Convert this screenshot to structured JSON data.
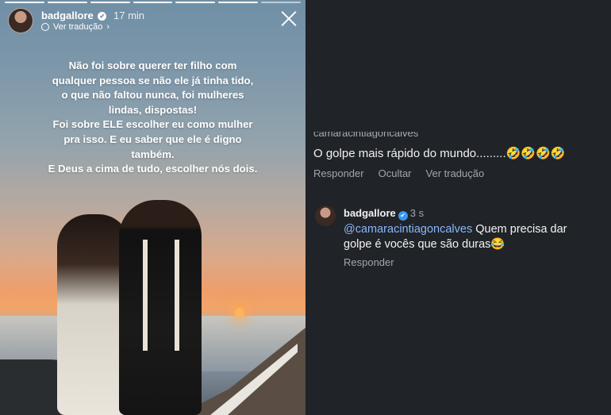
{
  "story": {
    "username": "badgallore",
    "time": "17 min",
    "translate_label": "Ver tradução",
    "translate_chevron": "›",
    "verified_mark": "✔",
    "text": "Não foi sobre querer ter filho com\nqualquer pessoa se não ele já tinha tido,\no que não faltou nunca, foi mulheres\nlindas, dispostas!\nFoi sobre ELE escolher eu como mulher\npra isso. E eu saber que ele é digno\ntambém.\nE Deus a cima de tudo, escolher nós dois.",
    "progress_segments": 7,
    "active_segments": 6
  },
  "comments": {
    "first_comment": {
      "username_partial": "camaracintiagoncalves",
      "text": "O golpe mais rápido do mundo.........🤣🤣🤣🤣",
      "actions": [
        "Responder",
        "Ocultar",
        "Ver tradução"
      ]
    },
    "reply": {
      "username": "badgallore",
      "verified_mark": "✔",
      "time": "3 s",
      "mention": "@camaracintiagoncalves",
      "text": " Quem precisa dar golpe é vocês que são duras😂",
      "actions": [
        "Responder"
      ]
    }
  },
  "colors": {
    "comments_bg": "#202327",
    "mention": "#8bb6ff",
    "verified_blue": "#3897f0"
  },
  "icons": [
    "close-icon",
    "globe-icon",
    "verified-icon",
    "chevron-right-icon"
  ]
}
